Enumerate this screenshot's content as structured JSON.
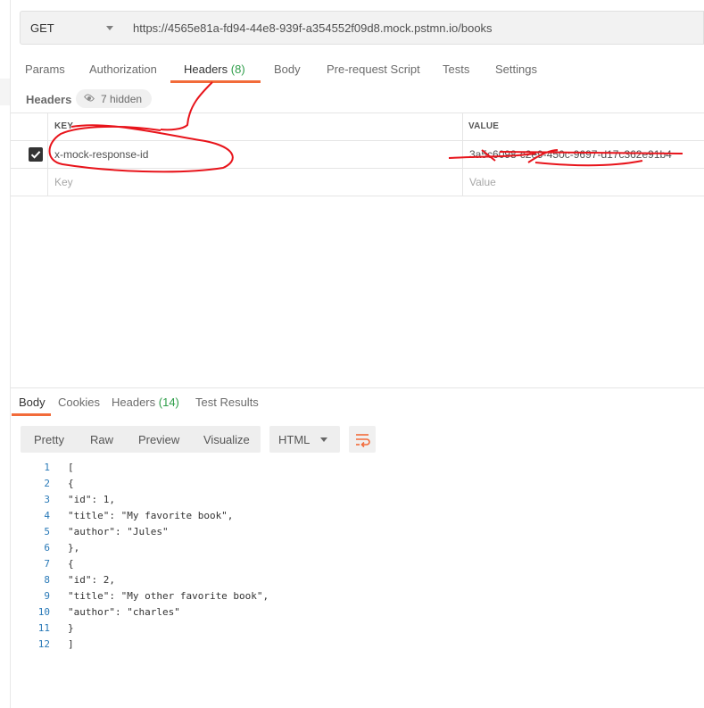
{
  "request": {
    "method": "GET",
    "url": "https://4565e81a-fd94-44e8-939f-a354552f09d8.mock.pstmn.io/books"
  },
  "request_tabs": {
    "params": "Params",
    "authorization": "Authorization",
    "headers": "Headers",
    "headers_count": "(8)",
    "body": "Body",
    "prerequest": "Pre-request Script",
    "tests": "Tests",
    "settings": "Settings"
  },
  "headers_section": {
    "label": "Headers",
    "hidden_label": "7 hidden"
  },
  "headers_table": {
    "col_key": "KEY",
    "col_value": "VALUE",
    "rows": [
      {
        "key": "x-mock-response-id",
        "value": "3a5c6098-c2e9-450c-9697-d17c362e91b4"
      }
    ],
    "key_placeholder": "Key",
    "value_placeholder": "Value"
  },
  "response_tabs": {
    "body": "Body",
    "cookies": "Cookies",
    "headers": "Headers",
    "headers_count": "(14)",
    "test_results": "Test Results"
  },
  "view_buttons": {
    "pretty": "Pretty",
    "raw": "Raw",
    "preview": "Preview",
    "visualize": "Visualize"
  },
  "format": "HTML",
  "code_lines": [
    {
      "num": "1",
      "text": "["
    },
    {
      "num": "2",
      "text": "{"
    },
    {
      "num": "3",
      "text": "\"id\": 1,"
    },
    {
      "num": "4",
      "text": "\"title\": \"My favorite book\","
    },
    {
      "num": "5",
      "text": "\"author\": \"Jules\""
    },
    {
      "num": "6",
      "text": "},"
    },
    {
      "num": "7",
      "text": "{"
    },
    {
      "num": "8",
      "text": "\"id\": 2,"
    },
    {
      "num": "9",
      "text": "\"title\": \"My other favorite book\","
    },
    {
      "num": "10",
      "text": "\"author\": \"charles\""
    },
    {
      "num": "11",
      "text": "}"
    },
    {
      "num": "12",
      "text": "]"
    }
  ],
  "colors": {
    "accent": "#f26b3a",
    "count_green": "#2f9e4a",
    "annotation_red": "#e8141b"
  }
}
